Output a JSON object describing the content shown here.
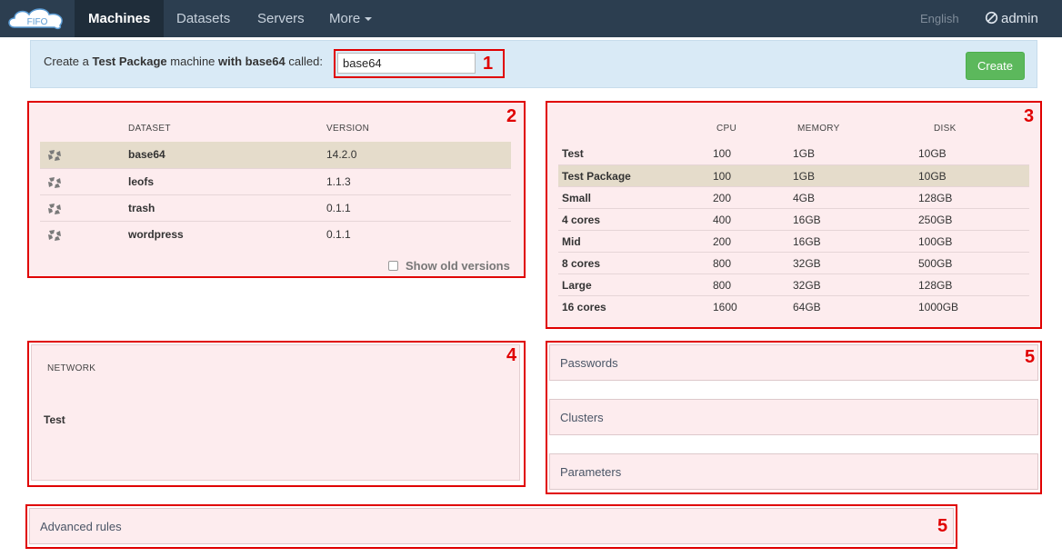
{
  "navbar": {
    "logo_text": "FIFO",
    "items": [
      {
        "label": "Machines",
        "active": true
      },
      {
        "label": "Datasets",
        "active": false
      },
      {
        "label": "Servers",
        "active": false
      },
      {
        "label": "More",
        "active": false
      }
    ],
    "language": "English",
    "user": "admin"
  },
  "create_bar": {
    "prefix": "Create a",
    "package": "Test Package",
    "middle": "machine",
    "with_label": "with",
    "dataset": "base64",
    "suffix": "called:",
    "name_value": "base64",
    "create_label": "Create"
  },
  "annotations": {
    "n1": "1",
    "n2": "2",
    "n3": "3",
    "n4": "4",
    "n5a": "5",
    "n5b": "5"
  },
  "datasets": {
    "headers": {
      "dataset": "DATASET",
      "version": "VERSION"
    },
    "rows": [
      {
        "name": "base64",
        "version": "14.2.0",
        "selected": true
      },
      {
        "name": "leofs",
        "version": "1.1.3",
        "selected": false
      },
      {
        "name": "trash",
        "version": "0.1.1",
        "selected": false
      },
      {
        "name": "wordpress",
        "version": "0.1.1",
        "selected": false
      }
    ],
    "show_old_label": "Show old versions"
  },
  "packages": {
    "headers": {
      "cpu": "CPU",
      "memory": "MEMORY",
      "disk": "DISK"
    },
    "rows": [
      {
        "name": "Test",
        "cpu": "100",
        "memory": "1GB",
        "disk": "10GB",
        "selected": false
      },
      {
        "name": "Test Package",
        "cpu": "100",
        "memory": "1GB",
        "disk": "10GB",
        "selected": true
      },
      {
        "name": "Small",
        "cpu": "200",
        "memory": "4GB",
        "disk": "128GB",
        "selected": false
      },
      {
        "name": "4 cores",
        "cpu": "400",
        "memory": "16GB",
        "disk": "250GB",
        "selected": false
      },
      {
        "name": "Mid",
        "cpu": "200",
        "memory": "16GB",
        "disk": "100GB",
        "selected": false
      },
      {
        "name": "8 cores",
        "cpu": "800",
        "memory": "32GB",
        "disk": "500GB",
        "selected": false
      },
      {
        "name": "Large",
        "cpu": "800",
        "memory": "32GB",
        "disk": "128GB",
        "selected": false
      },
      {
        "name": "16 cores",
        "cpu": "1600",
        "memory": "64GB",
        "disk": "1000GB",
        "selected": false
      }
    ]
  },
  "network": {
    "header": "NETWORK",
    "value": "Test"
  },
  "accordions": {
    "passwords": "Passwords",
    "clusters": "Clusters",
    "parameters": "Parameters",
    "advanced": "Advanced rules"
  },
  "colors": {
    "navbar": "#2c3e50",
    "annotation_red": "#e00000",
    "panel_pink": "#fdecee",
    "selected_row": "#e5dccb",
    "create_green": "#5cb85c"
  }
}
